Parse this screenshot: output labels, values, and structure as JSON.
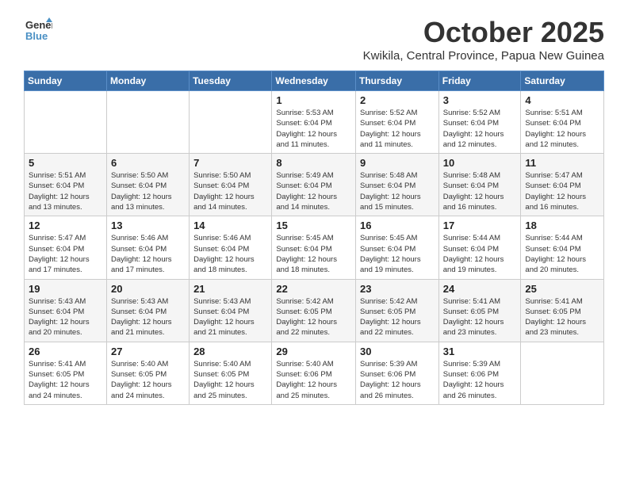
{
  "header": {
    "logo_line1": "General",
    "logo_line2": "Blue",
    "month": "October 2025",
    "location": "Kwikila, Central Province, Papua New Guinea"
  },
  "weekdays": [
    "Sunday",
    "Monday",
    "Tuesday",
    "Wednesday",
    "Thursday",
    "Friday",
    "Saturday"
  ],
  "weeks": [
    [
      {
        "day": "",
        "info": ""
      },
      {
        "day": "",
        "info": ""
      },
      {
        "day": "",
        "info": ""
      },
      {
        "day": "1",
        "info": "Sunrise: 5:53 AM\nSunset: 6:04 PM\nDaylight: 12 hours\nand 11 minutes."
      },
      {
        "day": "2",
        "info": "Sunrise: 5:52 AM\nSunset: 6:04 PM\nDaylight: 12 hours\nand 11 minutes."
      },
      {
        "day": "3",
        "info": "Sunrise: 5:52 AM\nSunset: 6:04 PM\nDaylight: 12 hours\nand 12 minutes."
      },
      {
        "day": "4",
        "info": "Sunrise: 5:51 AM\nSunset: 6:04 PM\nDaylight: 12 hours\nand 12 minutes."
      }
    ],
    [
      {
        "day": "5",
        "info": "Sunrise: 5:51 AM\nSunset: 6:04 PM\nDaylight: 12 hours\nand 13 minutes."
      },
      {
        "day": "6",
        "info": "Sunrise: 5:50 AM\nSunset: 6:04 PM\nDaylight: 12 hours\nand 13 minutes."
      },
      {
        "day": "7",
        "info": "Sunrise: 5:50 AM\nSunset: 6:04 PM\nDaylight: 12 hours\nand 14 minutes."
      },
      {
        "day": "8",
        "info": "Sunrise: 5:49 AM\nSunset: 6:04 PM\nDaylight: 12 hours\nand 14 minutes."
      },
      {
        "day": "9",
        "info": "Sunrise: 5:48 AM\nSunset: 6:04 PM\nDaylight: 12 hours\nand 15 minutes."
      },
      {
        "day": "10",
        "info": "Sunrise: 5:48 AM\nSunset: 6:04 PM\nDaylight: 12 hours\nand 16 minutes."
      },
      {
        "day": "11",
        "info": "Sunrise: 5:47 AM\nSunset: 6:04 PM\nDaylight: 12 hours\nand 16 minutes."
      }
    ],
    [
      {
        "day": "12",
        "info": "Sunrise: 5:47 AM\nSunset: 6:04 PM\nDaylight: 12 hours\nand 17 minutes."
      },
      {
        "day": "13",
        "info": "Sunrise: 5:46 AM\nSunset: 6:04 PM\nDaylight: 12 hours\nand 17 minutes."
      },
      {
        "day": "14",
        "info": "Sunrise: 5:46 AM\nSunset: 6:04 PM\nDaylight: 12 hours\nand 18 minutes."
      },
      {
        "day": "15",
        "info": "Sunrise: 5:45 AM\nSunset: 6:04 PM\nDaylight: 12 hours\nand 18 minutes."
      },
      {
        "day": "16",
        "info": "Sunrise: 5:45 AM\nSunset: 6:04 PM\nDaylight: 12 hours\nand 19 minutes."
      },
      {
        "day": "17",
        "info": "Sunrise: 5:44 AM\nSunset: 6:04 PM\nDaylight: 12 hours\nand 19 minutes."
      },
      {
        "day": "18",
        "info": "Sunrise: 5:44 AM\nSunset: 6:04 PM\nDaylight: 12 hours\nand 20 minutes."
      }
    ],
    [
      {
        "day": "19",
        "info": "Sunrise: 5:43 AM\nSunset: 6:04 PM\nDaylight: 12 hours\nand 20 minutes."
      },
      {
        "day": "20",
        "info": "Sunrise: 5:43 AM\nSunset: 6:04 PM\nDaylight: 12 hours\nand 21 minutes."
      },
      {
        "day": "21",
        "info": "Sunrise: 5:43 AM\nSunset: 6:04 PM\nDaylight: 12 hours\nand 21 minutes."
      },
      {
        "day": "22",
        "info": "Sunrise: 5:42 AM\nSunset: 6:05 PM\nDaylight: 12 hours\nand 22 minutes."
      },
      {
        "day": "23",
        "info": "Sunrise: 5:42 AM\nSunset: 6:05 PM\nDaylight: 12 hours\nand 22 minutes."
      },
      {
        "day": "24",
        "info": "Sunrise: 5:41 AM\nSunset: 6:05 PM\nDaylight: 12 hours\nand 23 minutes."
      },
      {
        "day": "25",
        "info": "Sunrise: 5:41 AM\nSunset: 6:05 PM\nDaylight: 12 hours\nand 23 minutes."
      }
    ],
    [
      {
        "day": "26",
        "info": "Sunrise: 5:41 AM\nSunset: 6:05 PM\nDaylight: 12 hours\nand 24 minutes."
      },
      {
        "day": "27",
        "info": "Sunrise: 5:40 AM\nSunset: 6:05 PM\nDaylight: 12 hours\nand 24 minutes."
      },
      {
        "day": "28",
        "info": "Sunrise: 5:40 AM\nSunset: 6:05 PM\nDaylight: 12 hours\nand 25 minutes."
      },
      {
        "day": "29",
        "info": "Sunrise: 5:40 AM\nSunset: 6:06 PM\nDaylight: 12 hours\nand 25 minutes."
      },
      {
        "day": "30",
        "info": "Sunrise: 5:39 AM\nSunset: 6:06 PM\nDaylight: 12 hours\nand 26 minutes."
      },
      {
        "day": "31",
        "info": "Sunrise: 5:39 AM\nSunset: 6:06 PM\nDaylight: 12 hours\nand 26 minutes."
      },
      {
        "day": "",
        "info": ""
      }
    ]
  ]
}
